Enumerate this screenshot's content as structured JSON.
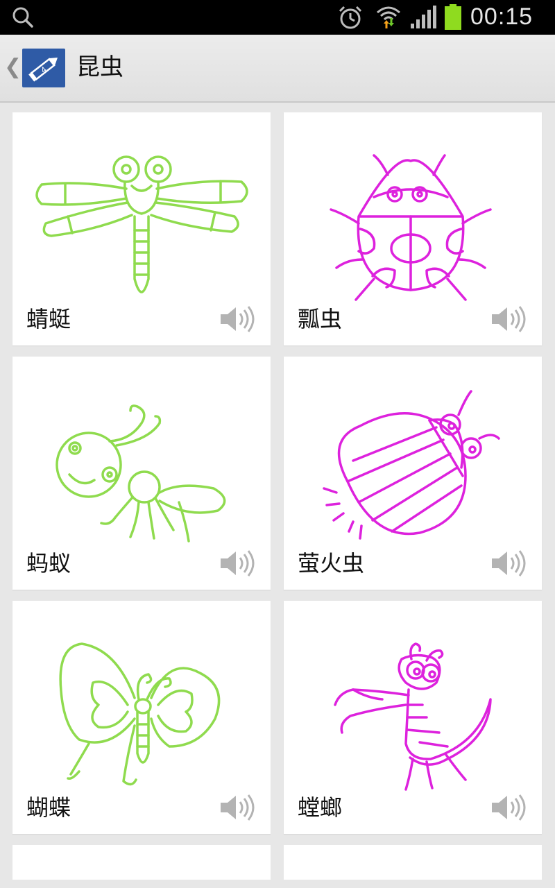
{
  "status_bar": {
    "time": "00:15",
    "icons": [
      "search-icon",
      "alarm-icon",
      "wifi-icon",
      "signal-icon",
      "battery-icon"
    ]
  },
  "action_bar": {
    "title": "昆虫",
    "icons": [
      "back-chevron-icon",
      "pencil-app-icon"
    ]
  },
  "insects": [
    {
      "name": "蜻蜓",
      "illustration": "dragonfly-drawing",
      "color": "#8fdb4e"
    },
    {
      "name": "瓢虫",
      "illustration": "ladybug-drawing",
      "color": "#dd22dd"
    },
    {
      "name": "蚂蚁",
      "illustration": "ant-drawing",
      "color": "#8fdb4e"
    },
    {
      "name": "萤火虫",
      "illustration": "firefly-drawing",
      "color": "#dd22dd"
    },
    {
      "name": "蝴蝶",
      "illustration": "butterfly-drawing",
      "color": "#8fdb4e"
    },
    {
      "name": "螳螂",
      "illustration": "mantis-drawing",
      "color": "#dd22dd"
    }
  ],
  "colors": {
    "green": "#8fdb4e",
    "magenta": "#dd22dd",
    "speaker_gray": "#b3b3b3",
    "logo_blue": "#2f5ba6"
  }
}
